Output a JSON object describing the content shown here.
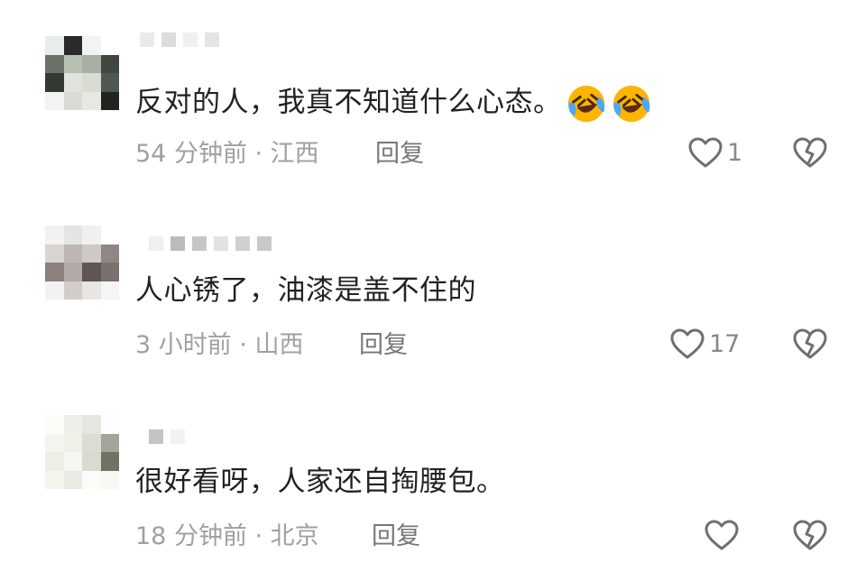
{
  "comments": [
    {
      "text": "反对的人，我真不知道什么心态。",
      "emojis": [
        "laughing-crying-emoji",
        "laughing-crying-emoji"
      ],
      "time": "54 分钟前",
      "location": "江西",
      "meta": "54 分钟前 · 江西",
      "reply_label": "回复",
      "likes": "1"
    },
    {
      "text": "人心锈了，油漆是盖不住的",
      "emojis": [],
      "time": "3 小时前",
      "location": "山西",
      "meta": "3 小时前 · 山西",
      "reply_label": "回复",
      "likes": "17"
    },
    {
      "text": "很好看呀，人家还自掏腰包。",
      "emojis": [],
      "time": "18 分钟前",
      "location": "北京",
      "meta": "18 分钟前 · 北京",
      "reply_label": "回复",
      "likes": ""
    }
  ],
  "icons": {
    "like": "heart-outline-icon",
    "dislike": "broken-heart-icon"
  },
  "colors": {
    "text": "#222222",
    "meta": "#a0a0a0",
    "reply": "#777777",
    "icon": "#6f6f6f",
    "emoji_face": "#ffb400"
  }
}
